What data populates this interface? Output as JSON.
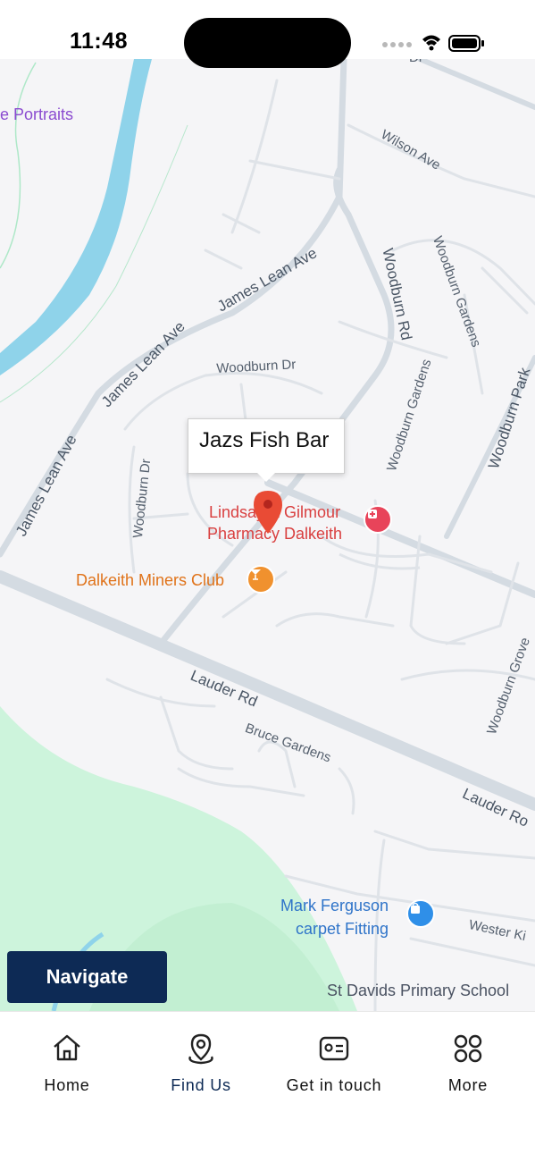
{
  "status_bar": {
    "time": "11:48"
  },
  "map": {
    "callout_title": "Jazs Fish Bar",
    "road_labels": {
      "wilson_ave": "Wilson Ave",
      "james_lean_ave_1": "James Lean Ave",
      "james_lean_ave_2": "James Lean Ave",
      "james_lean_ave_3": "James Lean Ave",
      "woodburn_rd": "Woodburn Rd",
      "woodburn_gardens_1": "Woodburn Gardens",
      "woodburn_gardens_2": "Woodburn Gardens",
      "woodburn_park": "Woodburn Park",
      "woodburn_dr_1": "Woodburn Dr",
      "woodburn_dr_2": "Woodburn Dr",
      "lauder_rd_1": "Lauder Rd",
      "lauder_rd_2": "Lauder Ro",
      "bruce_gardens": "Bruce Gardens",
      "woodburn_grove": "Woodburn Grove",
      "wester_ki": "Wester Ki",
      "top_dr": "Dr"
    },
    "pois": {
      "portraits": "e Portraits",
      "pharmacy_line1": "Lindsay & Gilmour",
      "pharmacy_line2": "Pharmacy Dalkeith",
      "miners_club": "Dalkeith Miners Club",
      "carpet_line1": "Mark Ferguson",
      "carpet_line2": "carpet Fitting",
      "school": "St Davids Primary School"
    },
    "navigate_label": "Navigate"
  },
  "tabbar": {
    "items": [
      {
        "label": "Home",
        "icon": "home-icon"
      },
      {
        "label": "Find Us",
        "icon": "location-pin-icon",
        "active": true
      },
      {
        "label": "Get in touch",
        "icon": "contact-card-icon"
      },
      {
        "label": "More",
        "icon": "grid-icon"
      }
    ]
  },
  "colors": {
    "accent": "#0d2a55",
    "water": "#8fd3ea",
    "park": "#cdf4dc",
    "road": "#d4dbe2"
  }
}
